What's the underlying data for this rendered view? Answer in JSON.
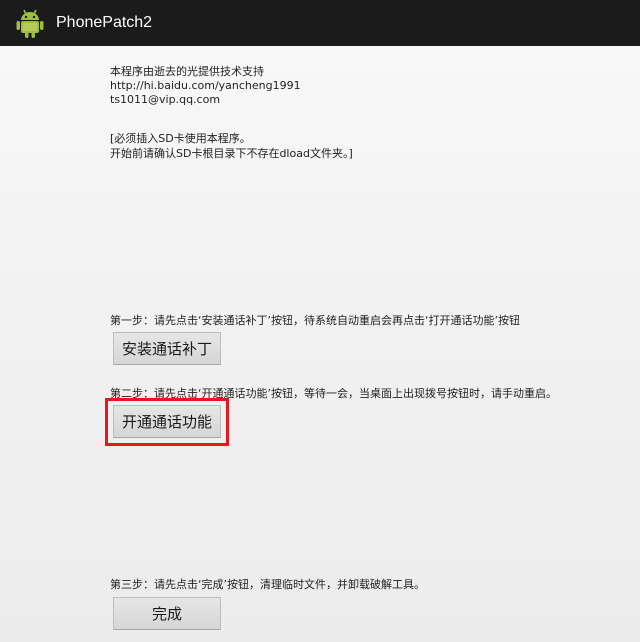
{
  "app": {
    "title": "PhonePatch2",
    "icon": "android-icon"
  },
  "about": {
    "line1": "本程序由逝去的光提供技术支持",
    "line2": "http://hi.baidu.com/yancheng1991",
    "line3": "ts1011@vip.qq.com"
  },
  "notice": {
    "line1": "[必须插入SD卡使用本程序。",
    "line2": "开始前请确认SD卡根目录下不存在dload文件夹。]"
  },
  "step1": {
    "text": "第一步：请先点击‘安装通话补丁’按钮，待系统自动重启会再点击‘打开通话功能’按钮",
    "button": "安装通话补丁"
  },
  "step2": {
    "text": "第二步：请先点击‘开通通话功能’按钮，等待一会，当桌面上出现拨号按钮时，请手动重启。",
    "button": "开通通话功能"
  },
  "step3": {
    "text": "第三步：请先点击‘完成’按钮，清理临时文件，并卸载破解工具。",
    "button": "完成"
  },
  "colors": {
    "titlebar": "#1b1b1b",
    "android_green": "#9fbf3b",
    "highlight": "#e5191c"
  }
}
